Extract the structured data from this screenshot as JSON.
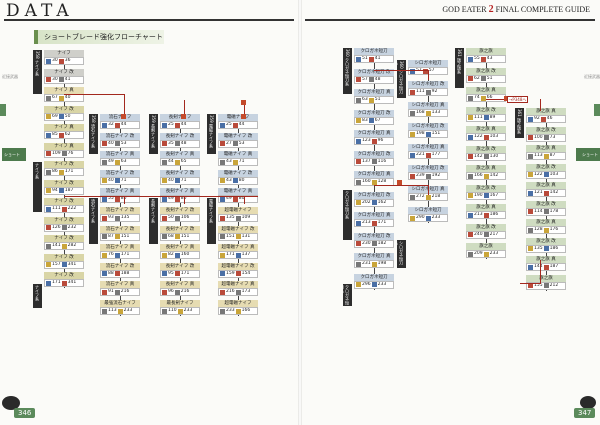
{
  "left_header": "DATA",
  "right_header": {
    "brand": "GOD EATER",
    "num": "2",
    "rest": "FINAL COMPLETE GUIDE"
  },
  "section_title": "ショートブレード強化フローチャート",
  "page_numbers": {
    "left": "346",
    "right": "347"
  },
  "sidebar_left": [
    "近接武器",
    "",
    "",
    "",
    "",
    "",
    "ショート",
    "",
    "",
    "",
    "",
    "",
    "",
    "",
    "",
    "",
    "",
    ""
  ],
  "sidebar_right": [
    "近接武器",
    "",
    "",
    "",
    "",
    "",
    "ショート",
    "",
    "",
    "",
    "",
    "",
    "",
    "",
    "",
    "",
    "",
    ""
  ],
  "red_tag": "→P348へ",
  "columns": [
    {
      "id": "c1",
      "label_a": "358",
      "label_b": "ナイフ系",
      "nodes": [
        {
          "name": "ナイフ",
          "stat": "30 36",
          "color": "gray"
        },
        {
          "name": "ナイフ 改",
          "stat": "30 41",
          "color": "gray"
        },
        {
          "name": "ナイフ 真",
          "stat": "67 40",
          "color": "tan"
        },
        {
          "name": "ナイフ 改",
          "stat": "69 50",
          "color": "olive"
        },
        {
          "name": "ナイフ 真",
          "stat": "85 62",
          "color": "olive"
        },
        {
          "name": "ナイフ 真",
          "stat": "109 76",
          "color": "olive"
        },
        {
          "name": "ナイフ 改",
          "stat": "86 171",
          "color": "olive"
        },
        {
          "name": "ナイフ 改",
          "stat": "94 187",
          "color": "olive"
        },
        {
          "name": "ナイフ 改",
          "stat": "111 222",
          "color": "olive"
        },
        {
          "name": "ナイフ 改",
          "stat": "126 232",
          "color": "olive"
        },
        {
          "name": "ナイフ 改",
          "stat": "141 282",
          "color": "olive"
        },
        {
          "name": "ナイフ 改",
          "stat": "157 341",
          "color": "olive"
        },
        {
          "name": "ナイフ 改",
          "stat": "171 341",
          "color": "olive"
        }
      ]
    },
    {
      "id": "c2",
      "label_a": "358",
      "label_b": "流石ナイフ系",
      "nodes": [
        {
          "name": "流石ナイフ",
          "stat": "32 44",
          "color": "blue"
        },
        {
          "name": "流石ナイフ 改",
          "stat": "40 53",
          "color": "blue"
        },
        {
          "name": "流石ナイフ 真",
          "stat": "49 63",
          "color": "blue"
        },
        {
          "name": "流石ナイフ 改",
          "stat": "40 71",
          "color": "blue"
        },
        {
          "name": "流石ナイフ 真",
          "stat": "55 80",
          "color": "blue"
        },
        {
          "name": "流石ナイフ 改",
          "stat": "93 135",
          "color": "tan"
        },
        {
          "name": "流石ナイフ 改",
          "stat": "87 151",
          "color": "tan"
        },
        {
          "name": "流石ナイフ 真",
          "stat": "76 171",
          "color": "tan"
        },
        {
          "name": "流石ナイフ 改",
          "stat": "88 188",
          "color": "tan"
        },
        {
          "name": "流石ナイフ 真",
          "stat": "91 216",
          "color": "tan"
        },
        {
          "name": "最強流石ナイフ",
          "stat": "113 233",
          "color": "tan"
        }
      ]
    },
    {
      "id": "c3",
      "label_a": "359",
      "label_b": "長剣ナイフ系",
      "nodes": [
        {
          "name": "長剣ナイフ",
          "stat": "25 44",
          "color": "blue"
        },
        {
          "name": "長剣ナイフ 改",
          "stat": "35 48",
          "color": "blue"
        },
        {
          "name": "長剣ナイフ 真",
          "stat": "44 65",
          "color": "blue"
        },
        {
          "name": "長剣ナイフ 改",
          "stat": "40 71",
          "color": "blue"
        },
        {
          "name": "長剣ナイフ 真",
          "stat": "49 80",
          "color": "blue"
        },
        {
          "name": "長剣ナイフ 改",
          "stat": "50 106",
          "color": "tan"
        },
        {
          "name": "長剣ナイフ 改",
          "stat": "68 151",
          "color": "tan"
        },
        {
          "name": "長剣ナイフ 真",
          "stat": "82 160",
          "color": "tan"
        },
        {
          "name": "長剣ナイフ 改",
          "stat": "95 171",
          "color": "tan"
        },
        {
          "name": "長剣ナイフ 真",
          "stat": "96 216",
          "color": "tan"
        },
        {
          "name": "最長剣ナイフ",
          "stat": "110 233",
          "color": "tan"
        }
      ]
    },
    {
      "id": "c4",
      "label_a": "359",
      "label_b": "電磁ナイフ系",
      "nodes": [
        {
          "name": "電磁ナイフ",
          "stat": "25 44",
          "color": "blue"
        },
        {
          "name": "電磁ナイフ 改",
          "stat": "27 53",
          "color": "blue"
        },
        {
          "name": "電磁ナイフ 真",
          "stat": "43 71",
          "color": "blue"
        },
        {
          "name": "電磁ナイフ 改",
          "stat": "43 80",
          "color": "blue"
        },
        {
          "name": "電磁ナイフ 真",
          "stat": "49 80",
          "color": "blue"
        },
        {
          "name": "超電磁ナイフ",
          "stat": "135 109",
          "color": "tan"
        },
        {
          "name": "超電磁ナイフ 改",
          "stat": "151 131",
          "color": "tan"
        },
        {
          "name": "超電磁ナイフ 真",
          "stat": "171 137",
          "color": "tan"
        },
        {
          "name": "超電磁ナイフ 改",
          "stat": "159 154",
          "color": "tan"
        },
        {
          "name": "超電磁ナイフ 真",
          "stat": "216 173",
          "color": "tan"
        },
        {
          "name": "超電磁ナイフ",
          "stat": "233 166",
          "color": "tan"
        }
      ]
    },
    {
      "id": "c5",
      "label_a": "360",
      "label_b": "クロガネ短刀系",
      "nodes": [
        {
          "name": "クロガネ短刀",
          "stat": "51 41",
          "color": "blue"
        },
        {
          "name": "クロガネ短刀 改",
          "stat": "57 48",
          "color": "blue"
        },
        {
          "name": "クロガネ短刀 真",
          "stat": "63 51",
          "color": "blue"
        },
        {
          "name": "クロガネ短刀 改",
          "stat": "83 67",
          "color": "blue"
        },
        {
          "name": "クロガネ短刀 真",
          "stat": "123 96",
          "color": "blue"
        },
        {
          "name": "クロガネ短刀 改",
          "stat": "137 116",
          "color": "blue"
        },
        {
          "name": "クロガネ短刀 真",
          "stat": "160 128",
          "color": "blue"
        },
        {
          "name": "クロガネ短刀 改",
          "stat": "202 162",
          "color": "blue"
        },
        {
          "name": "クロガネ短刀 真",
          "stat": "213 171",
          "color": "blue"
        },
        {
          "name": "クロガネ短刀 改",
          "stat": "230 182",
          "color": "blue"
        },
        {
          "name": "クロガネ短刀 真",
          "stat": "231 198",
          "color": "blue"
        },
        {
          "name": "クロガネ短刀",
          "stat": "296 233",
          "color": "blue"
        }
      ]
    },
    {
      "id": "c6",
      "label_a": "360",
      "label_b": "シロガネ短刀系",
      "nodes": [
        {
          "name": "シロガネ短刀",
          "stat": "57 57",
          "color": "blue"
        },
        {
          "name": "シロガネ短刀 改",
          "stat": "111 92",
          "color": "blue"
        },
        {
          "name": "シロガネ短刀 真",
          "stat": "168 133",
          "color": "blue"
        },
        {
          "name": "シロガネ短刀 改",
          "stat": "198 151",
          "color": "blue"
        },
        {
          "name": "シロガネ短刀 真",
          "stat": "221 177",
          "color": "blue"
        },
        {
          "name": "シロガネ短刀 改",
          "stat": "239 192",
          "color": "blue"
        },
        {
          "name": "シロガネ短刀 真",
          "stat": "272 218",
          "color": "blue"
        },
        {
          "name": "シロガネ短刀",
          "stat": "290 233",
          "color": "blue"
        }
      ]
    },
    {
      "id": "c7",
      "label_a": "361",
      "label_b": "旗之旗系",
      "nodes": [
        {
          "name": "旗之旗",
          "stat": "55 43",
          "color": "green"
        },
        {
          "name": "旗之旗 改",
          "stat": "62 51",
          "color": "green"
        },
        {
          "name": "旗之旗 真",
          "stat": "74 66",
          "color": "green"
        },
        {
          "name": "旗之旗 改",
          "stat": "111 89",
          "color": "green"
        },
        {
          "name": "旗之旗 真",
          "stat": "122 103",
          "color": "green"
        },
        {
          "name": "旗之旗 改",
          "stat": "142 130",
          "color": "green"
        },
        {
          "name": "旗之旗 真",
          "stat": "166 142",
          "color": "green"
        },
        {
          "name": "旗之旗 改",
          "stat": "190 167",
          "color": "green"
        },
        {
          "name": "旗之旗 真",
          "stat": "213 186",
          "color": "green"
        },
        {
          "name": "旗之旗 改",
          "stat": "240 217",
          "color": "green"
        },
        {
          "name": "旗之旗",
          "stat": "209 233",
          "color": "green"
        }
      ]
    },
    {
      "id": "c8",
      "label_a": "361",
      "label_b": "旗之旗系",
      "nodes": [
        {
          "name": "旗之旗 真",
          "stat": "92 46",
          "color": "green"
        },
        {
          "name": "旗之旗 改",
          "stat": "100 73",
          "color": "green"
        },
        {
          "name": "旗之旗 真",
          "stat": "113 87",
          "color": "green"
        },
        {
          "name": "旗之旗 改",
          "stat": "122 103",
          "color": "green"
        },
        {
          "name": "旗之旗 真",
          "stat": "121 142",
          "color": "green"
        },
        {
          "name": "旗之旗 改",
          "stat": "114 178",
          "color": "green"
        },
        {
          "name": "旗之旗 真",
          "stat": "128 176",
          "color": "green"
        },
        {
          "name": "旗之旗 改",
          "stat": "135 186",
          "color": "green"
        },
        {
          "name": "旗之旗 真",
          "stat": "144 187",
          "color": "green"
        },
        {
          "name": "旗之旗",
          "stat": "155 212",
          "color": "green"
        }
      ]
    }
  ]
}
